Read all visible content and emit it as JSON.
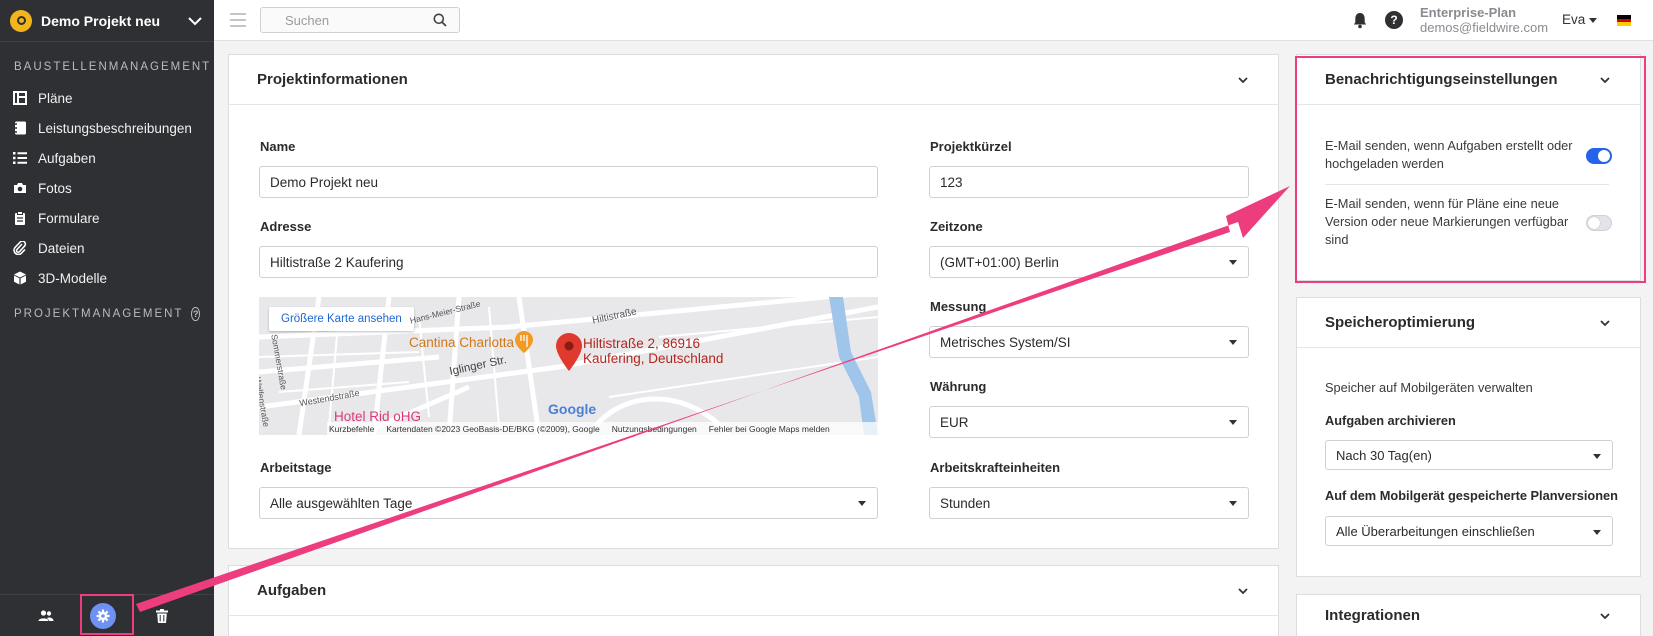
{
  "sidebar": {
    "project_name": "Demo Projekt neu",
    "section_site": "BAUSTELLENMANAGEMENT",
    "items": [
      {
        "label": "Pläne",
        "icon": "plans-icon"
      },
      {
        "label": "Leistungsbeschreibungen",
        "icon": "notebook-icon"
      },
      {
        "label": "Aufgaben",
        "icon": "list-icon"
      },
      {
        "label": "Fotos",
        "icon": "camera-icon"
      },
      {
        "label": "Formulare",
        "icon": "clipboard-icon"
      },
      {
        "label": "Dateien",
        "icon": "paperclip-icon"
      },
      {
        "label": "3D-Modelle",
        "icon": "cube-icon"
      }
    ],
    "section_project": "PROJEKTMANAGEMENT",
    "footer": {
      "users_icon": "users-icon",
      "settings_icon": "gear-icon",
      "trash_icon": "trash-icon"
    }
  },
  "topbar": {
    "search_placeholder": "Suchen",
    "plan": "Enterprise-Plan",
    "email": "demos@fieldwire.com",
    "user": "Eva"
  },
  "project_info": {
    "title": "Projektinformationen",
    "name_label": "Name",
    "name_value": "Demo Projekt neu",
    "short_label": "Projektkürzel",
    "short_value": "123",
    "address_label": "Adresse",
    "address_value": "Hiltistraße 2 Kaufering",
    "timezone_label": "Zeitzone",
    "timezone_value": "(GMT+01:00) Berlin",
    "measure_label": "Messung",
    "measure_value": "Metrisches System/SI",
    "currency_label": "Währung",
    "currency_value": "EUR",
    "workdays_label": "Arbeitstage",
    "workdays_value": "Alle ausgewählten Tage",
    "labor_label": "Arbeitskrafteinheiten",
    "labor_value": "Stunden"
  },
  "map": {
    "bigger_map": "Größere Karte ansehen",
    "place_name": "Cantina Charlotta",
    "pin_label_1": "Hiltistraße 2, 86916",
    "pin_label_2": "Kaufering, Deutschland",
    "hotel": "Hotel Rid oHG",
    "street_1": "Hiltistraße",
    "street_2": "Iglinger Str.",
    "street_3": "Westendstraße",
    "street_4": "Sommerstraße",
    "street_5": "Welfenstraße",
    "street_6": "Hans-Meier-Straße",
    "google": "Google",
    "footer": [
      "Kurzbefehle",
      "Kartendaten ©2023 GeoBasis-DE/BKG (©2009), Google",
      "Nutzungsbedingungen",
      "Fehler bei Google Maps melden"
    ]
  },
  "tasks_card": {
    "title": "Aufgaben"
  },
  "notifications": {
    "title": "Benachrichtigungseinstellungen",
    "row1": "E-Mail senden, wenn Aufgaben erstellt oder hochgeladen werden",
    "row1_on": true,
    "row2": "E-Mail senden, wenn für Pläne eine neue Version oder neue Markierungen verfügbar sind",
    "row2_on": false
  },
  "storage": {
    "title": "Speicheroptimierung",
    "subtitle": "Speicher auf Mobilgeräten verwalten",
    "archive_label": "Aufgaben archivieren",
    "archive_value": "Nach 30 Tag(en)",
    "versions_label": "Auf dem Mobilgerät gespeicherte Planversionen",
    "versions_value": "Alle Überarbeitungen einschließen"
  },
  "integrations": {
    "title": "Integrationen"
  },
  "colors": {
    "highlight": "#ee3d7e",
    "toggle_on": "#2563eb",
    "sidebar": "#2f3033"
  }
}
